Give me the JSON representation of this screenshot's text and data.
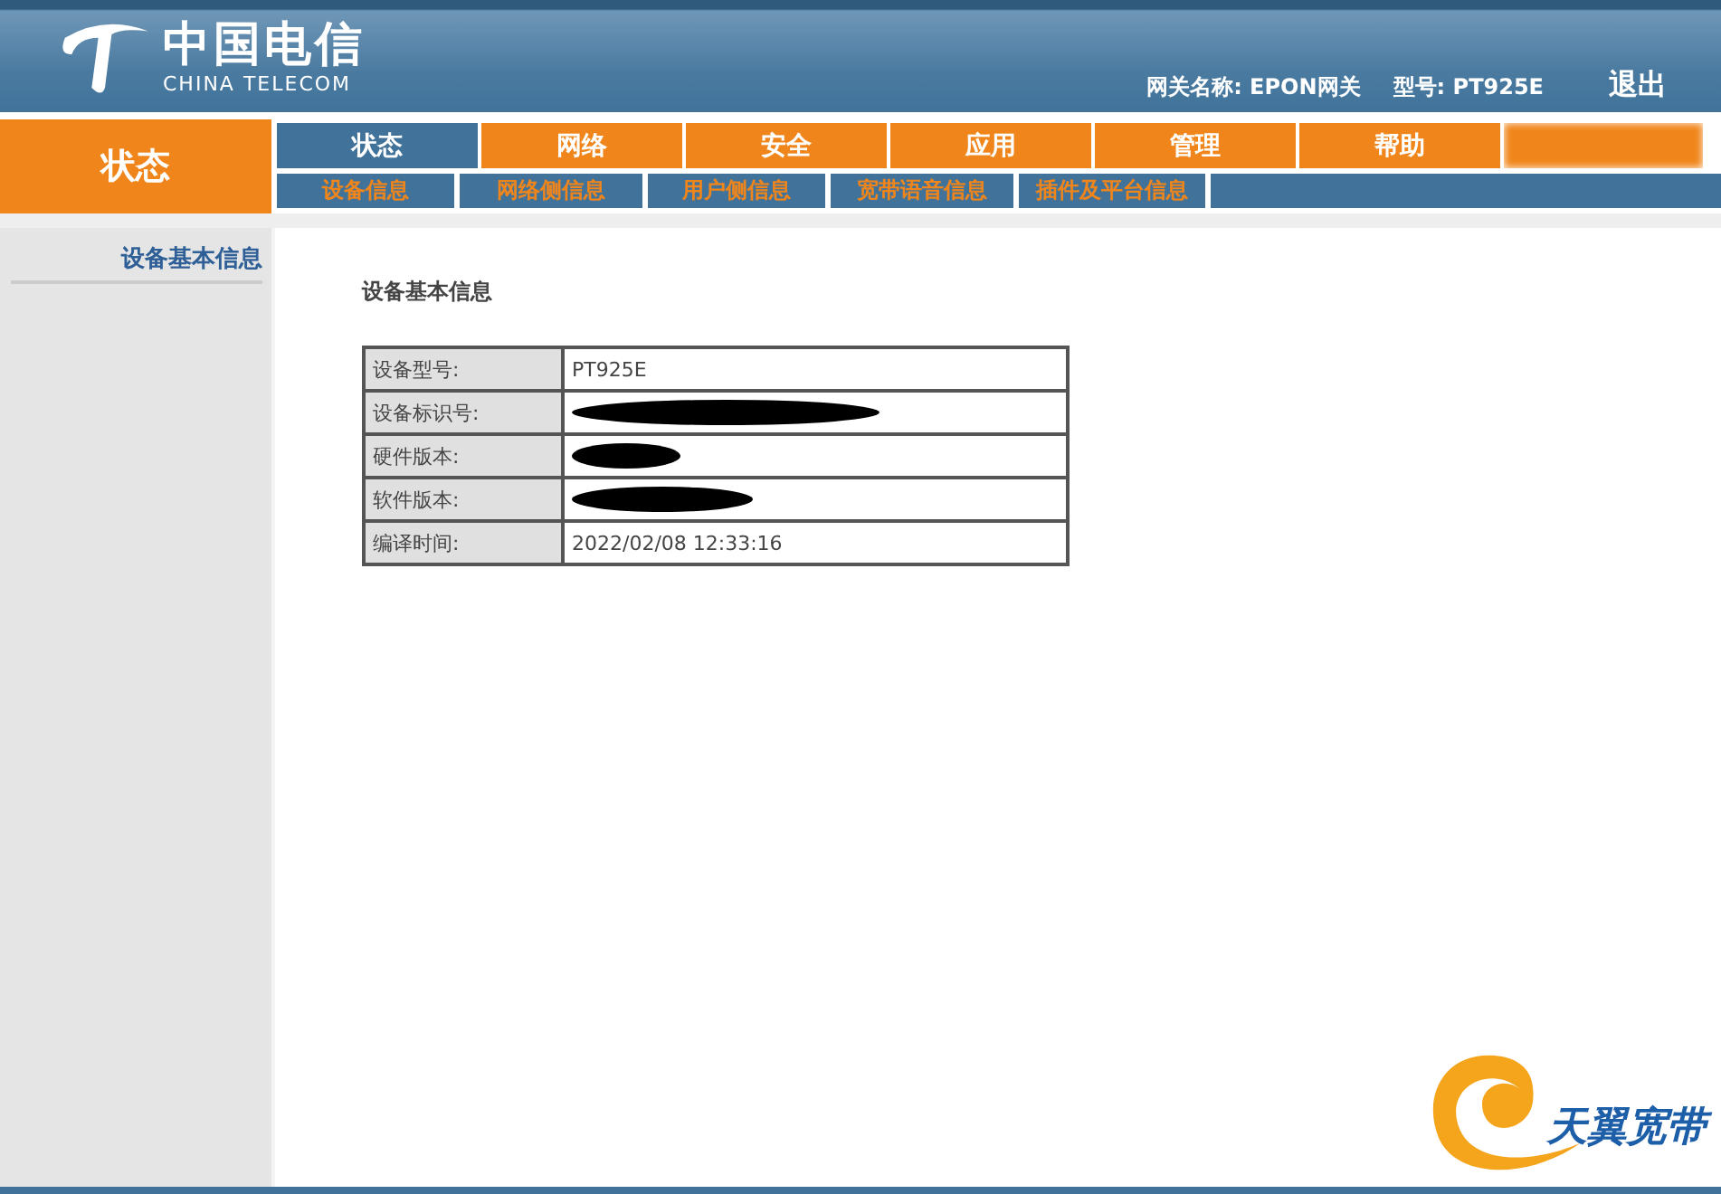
{
  "header": {
    "logo_cn": "中国电信",
    "logo_en": "CHINA TELECOM",
    "gateway": "网关名称: EPON网关",
    "model": "型号: PT925E",
    "logout": "退出"
  },
  "section_title": "状态",
  "tabs": [
    {
      "label": "状态",
      "selected": true
    },
    {
      "label": "网络",
      "selected": false
    },
    {
      "label": "安全",
      "selected": false
    },
    {
      "label": "应用",
      "selected": false
    },
    {
      "label": "管理",
      "selected": false
    },
    {
      "label": "帮助",
      "selected": false
    }
  ],
  "subtabs": [
    {
      "label": "设备信息",
      "selected": false
    },
    {
      "label": "网络侧信息",
      "selected": false
    },
    {
      "label": "用户侧信息",
      "selected": false
    },
    {
      "label": "宽带语音信息",
      "selected": false
    },
    {
      "label": "插件及平台信息",
      "selected": false
    }
  ],
  "sidebar": {
    "items": [
      {
        "label": "设备基本信息",
        "selected": true
      }
    ]
  },
  "content_title": "设备基本信息",
  "table": {
    "rows": [
      {
        "label": "设备型号:",
        "value": "PT925E",
        "redacted": false
      },
      {
        "label": "设备标识号:",
        "redacted": true
      },
      {
        "label": "硬件版本:",
        "redacted": true
      },
      {
        "label": "软件版本:",
        "redacted": true
      },
      {
        "label": "编译时间:",
        "value": "2022/02/08 12:33:16",
        "redacted": false
      }
    ]
  },
  "footer_logo": "天翼宽带"
}
